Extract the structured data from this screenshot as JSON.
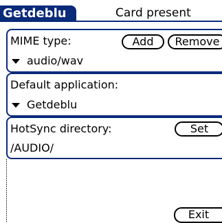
{
  "colors": {
    "accent": "#0a2a7a"
  },
  "app": {
    "title": "Getdeblu",
    "status": "Card present"
  },
  "mime": {
    "label": "MIME type:",
    "value": "audio/wav",
    "add_label": "Add",
    "remove_label": "Remove"
  },
  "default_app": {
    "label": "Default application:",
    "value": "Getdeblu"
  },
  "hotsync": {
    "label": "HotSync directory:",
    "set_label": "Set",
    "path": "/AUDIO/"
  },
  "footer": {
    "exit_label": "Exit"
  }
}
